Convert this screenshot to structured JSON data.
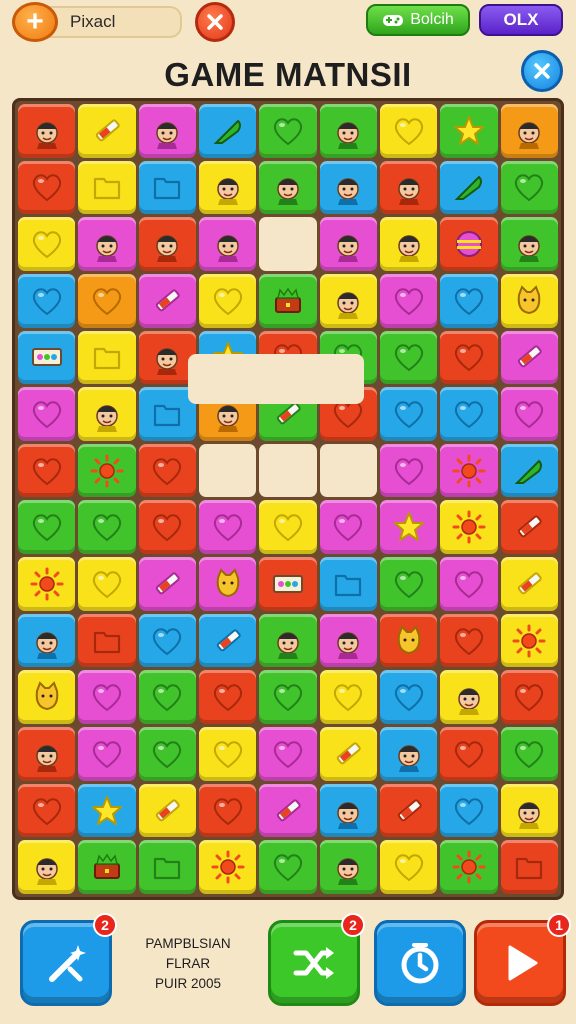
{
  "header": {
    "add_icon": "plus-icon",
    "player_name": "Pixacl",
    "green_button_label": "Bolcih",
    "purple_button_label": "OLX",
    "title": "GAME MATNSII"
  },
  "colors": {
    "red": "#e8431e",
    "yellow": "#f9e21a",
    "pink": "#e64fd1",
    "blue": "#26a8e8",
    "green": "#41c42b",
    "orange": "#f59a16"
  },
  "board": {
    "rows": 14,
    "cols": 9,
    "tiles": [
      [
        "red:face",
        "yellow:pencil",
        "pink:face",
        "blue:leaf",
        "green:heart",
        "green:face",
        "yellow:heart",
        "green:star",
        "orange:face"
      ],
      [
        "red:heart",
        "yellow:folder",
        "blue:folder",
        "yellow:face",
        "green:face",
        "blue:face",
        "red:face",
        "blue:leaf",
        "green:heart"
      ],
      [
        "yellow:heart",
        "pink:face",
        "red:face",
        "pink:face",
        "empty",
        "pink:face",
        "yellow:face",
        "red:ball",
        "green:face"
      ],
      [
        "blue:heart",
        "orange:heart",
        "pink:pencil",
        "yellow:heart",
        "green:chest",
        "yellow:face",
        "pink:heart",
        "blue:heart",
        "yellow:cat"
      ],
      [
        "blue:ticket",
        "yellow:folder",
        "red:face",
        "blue:star",
        "red:heart",
        "green:heart",
        "green:heart",
        "red:heart",
        "pink:pencil"
      ],
      [
        "pink:heart",
        "yellow:face",
        "blue:folder",
        "orange:face",
        "green:pencil",
        "red:heart",
        "blue:heart",
        "blue:heart",
        "pink:heart"
      ],
      [
        "red:heart",
        "green:sun",
        "red:heart",
        "blank",
        "blank",
        "blank",
        "pink:heart",
        "pink:sun",
        "blue:leaf"
      ],
      [
        "green:heart",
        "green:heart",
        "red:heart",
        "pink:heart",
        "yellow:heart",
        "pink:heart",
        "pink:star",
        "yellow:sun",
        "red:pencil"
      ],
      [
        "yellow:sun",
        "yellow:heart",
        "pink:pencil",
        "pink:cat",
        "red:ticket",
        "blue:folder",
        "green:heart",
        "pink:heart",
        "yellow:pencil"
      ],
      [
        "blue:face",
        "red:folder",
        "blue:heart",
        "blue:pencil",
        "green:face",
        "pink:face",
        "red:cat",
        "red:heart",
        "yellow:sun"
      ],
      [
        "yellow:cat",
        "pink:heart",
        "green:heart",
        "red:heart",
        "green:heart",
        "yellow:heart",
        "blue:heart",
        "yellow:face",
        "red:heart"
      ],
      [
        "red:face",
        "pink:heart",
        "green:heart",
        "yellow:heart",
        "pink:heart",
        "yellow:pencil",
        "blue:face",
        "red:heart",
        "green:heart"
      ],
      [
        "red:heart",
        "blue:star",
        "yellow:pencil",
        "red:heart",
        "pink:pencil",
        "blue:face",
        "red:pencil",
        "blue:heart",
        "yellow:face"
      ],
      [
        "yellow:face",
        "green:chest",
        "green:folder",
        "yellow:sun",
        "green:heart",
        "green:face",
        "yellow:heart",
        "green:sun",
        "red:folder"
      ]
    ]
  },
  "footer": {
    "hint_badge": "2",
    "info_line1": "PAMPBLSIAN",
    "info_line2": "FLRAR",
    "info_line3": "PUIR 2005",
    "shuffle_badge": "2",
    "play_badge": "1"
  }
}
